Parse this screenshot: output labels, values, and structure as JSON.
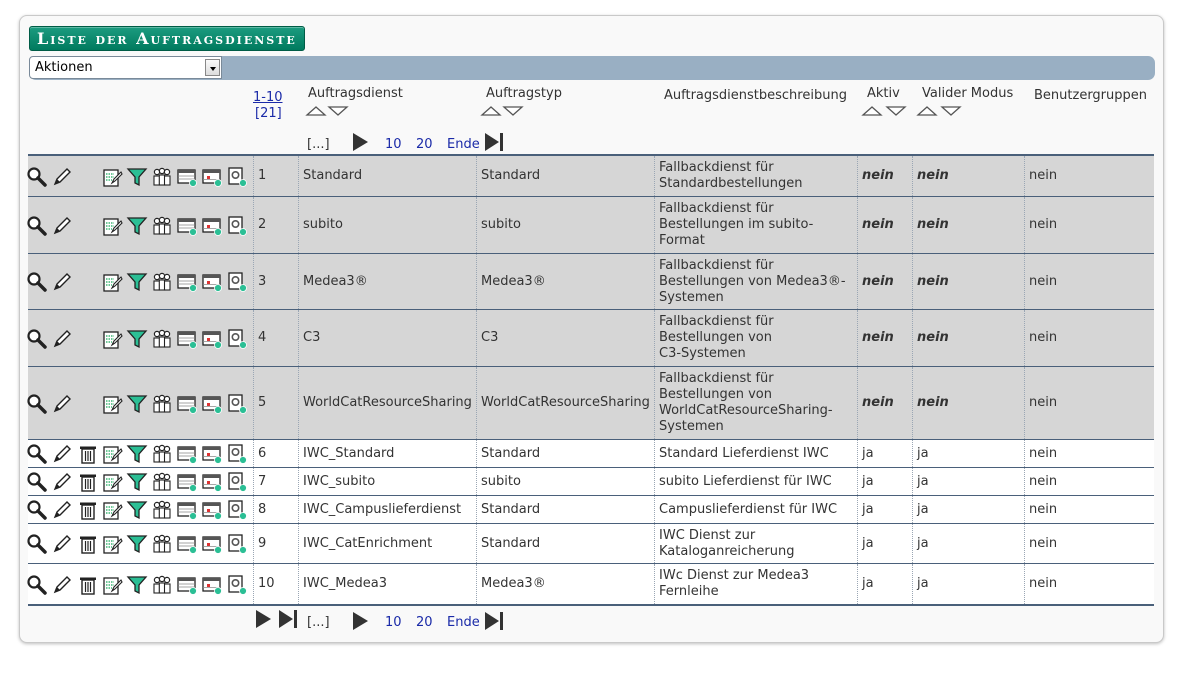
{
  "title": "Liste der Auftragsdienste",
  "actions": {
    "selected": "Aktionen"
  },
  "pager": {
    "range": "1-10",
    "total": "[21]",
    "dots": "[...]",
    "p10": "10",
    "p20": "20",
    "end": "Ende"
  },
  "columns": {
    "dienst": "Auftragsdienst",
    "typ": "Auftragstyp",
    "beschreibung": "Auftragsdienstbeschreibung",
    "aktiv": "Aktiv",
    "valider": "Valider Modus",
    "gruppen": "Benutzergruppen"
  },
  "rows": [
    {
      "nr": "1",
      "dienst": "Standard",
      "typ": "Standard",
      "desc": [
        "Fallbackdienst für",
        "Standardbestellungen"
      ],
      "aktiv": "nein",
      "valider": "nein",
      "gruppen": "nein"
    },
    {
      "nr": "2",
      "dienst": "subito",
      "typ": "subito",
      "desc": [
        "Fallbackdienst für",
        "Bestellungen im subito-",
        "Format"
      ],
      "aktiv": "nein",
      "valider": "nein",
      "gruppen": "nein"
    },
    {
      "nr": "3",
      "dienst": "Medea3®",
      "typ": "Medea3®",
      "desc": [
        "Fallbackdienst für",
        "Bestellungen von Medea3®-",
        "Systemen"
      ],
      "aktiv": "nein",
      "valider": "nein",
      "gruppen": "nein"
    },
    {
      "nr": "4",
      "dienst": "C3",
      "typ": "C3",
      "desc": [
        "Fallbackdienst für",
        "Bestellungen von",
        "C3-Systemen"
      ],
      "aktiv": "nein",
      "valider": "nein",
      "gruppen": "nein"
    },
    {
      "nr": "5",
      "dienst": "WorldCatResourceSharing",
      "typ": "WorldCatResourceSharing",
      "desc": [
        "Fallbackdienst für",
        "Bestellungen von",
        "WorldCatResourceSharing-",
        "Systemen"
      ],
      "aktiv": "nein",
      "valider": "nein",
      "gruppen": "nein"
    },
    {
      "nr": "6",
      "dienst": "IWC_Standard",
      "typ": "Standard",
      "desc": [
        "Standard Lieferdienst IWC"
      ],
      "aktiv": "ja",
      "valider": "ja",
      "gruppen": "nein"
    },
    {
      "nr": "7",
      "dienst": "IWC_subito",
      "typ": "subito",
      "desc": [
        "subito Lieferdienst für IWC"
      ],
      "aktiv": "ja",
      "valider": "ja",
      "gruppen": "nein"
    },
    {
      "nr": "8",
      "dienst": "IWC_Campuslieferdienst",
      "typ": "Standard",
      "desc": [
        "Campuslieferdienst für IWC"
      ],
      "aktiv": "ja",
      "valider": "ja",
      "gruppen": "nein"
    },
    {
      "nr": "9",
      "dienst": "IWC_CatEnrichment",
      "typ": "Standard",
      "desc": [
        "IWC Dienst zur",
        "Kataloganreicherung"
      ],
      "aktiv": "ja",
      "valider": "ja",
      "gruppen": "nein"
    },
    {
      "nr": "10",
      "dienst": "IWC_Medea3",
      "typ": "Medea3®",
      "desc": [
        "IWc Dienst zur Medea3",
        "Fernleihe"
      ],
      "aktiv": "ja",
      "valider": "ja",
      "gruppen": "nein"
    }
  ],
  "icons": {
    "view": "magnifier-icon",
    "edit": "pencil-icon",
    "delete": "trash-icon",
    "config": "edit-list-icon",
    "filter": "filter-icon",
    "groups": "user-groups-icon",
    "calendar": "table-add-icon",
    "calendar2": "table-delete-icon",
    "copy": "document-settings-icon"
  },
  "colors": {
    "accent": "#008a6c",
    "bar": "#99afc3",
    "grey_row": "#d6d6d6",
    "link": "#1a2aa8"
  }
}
